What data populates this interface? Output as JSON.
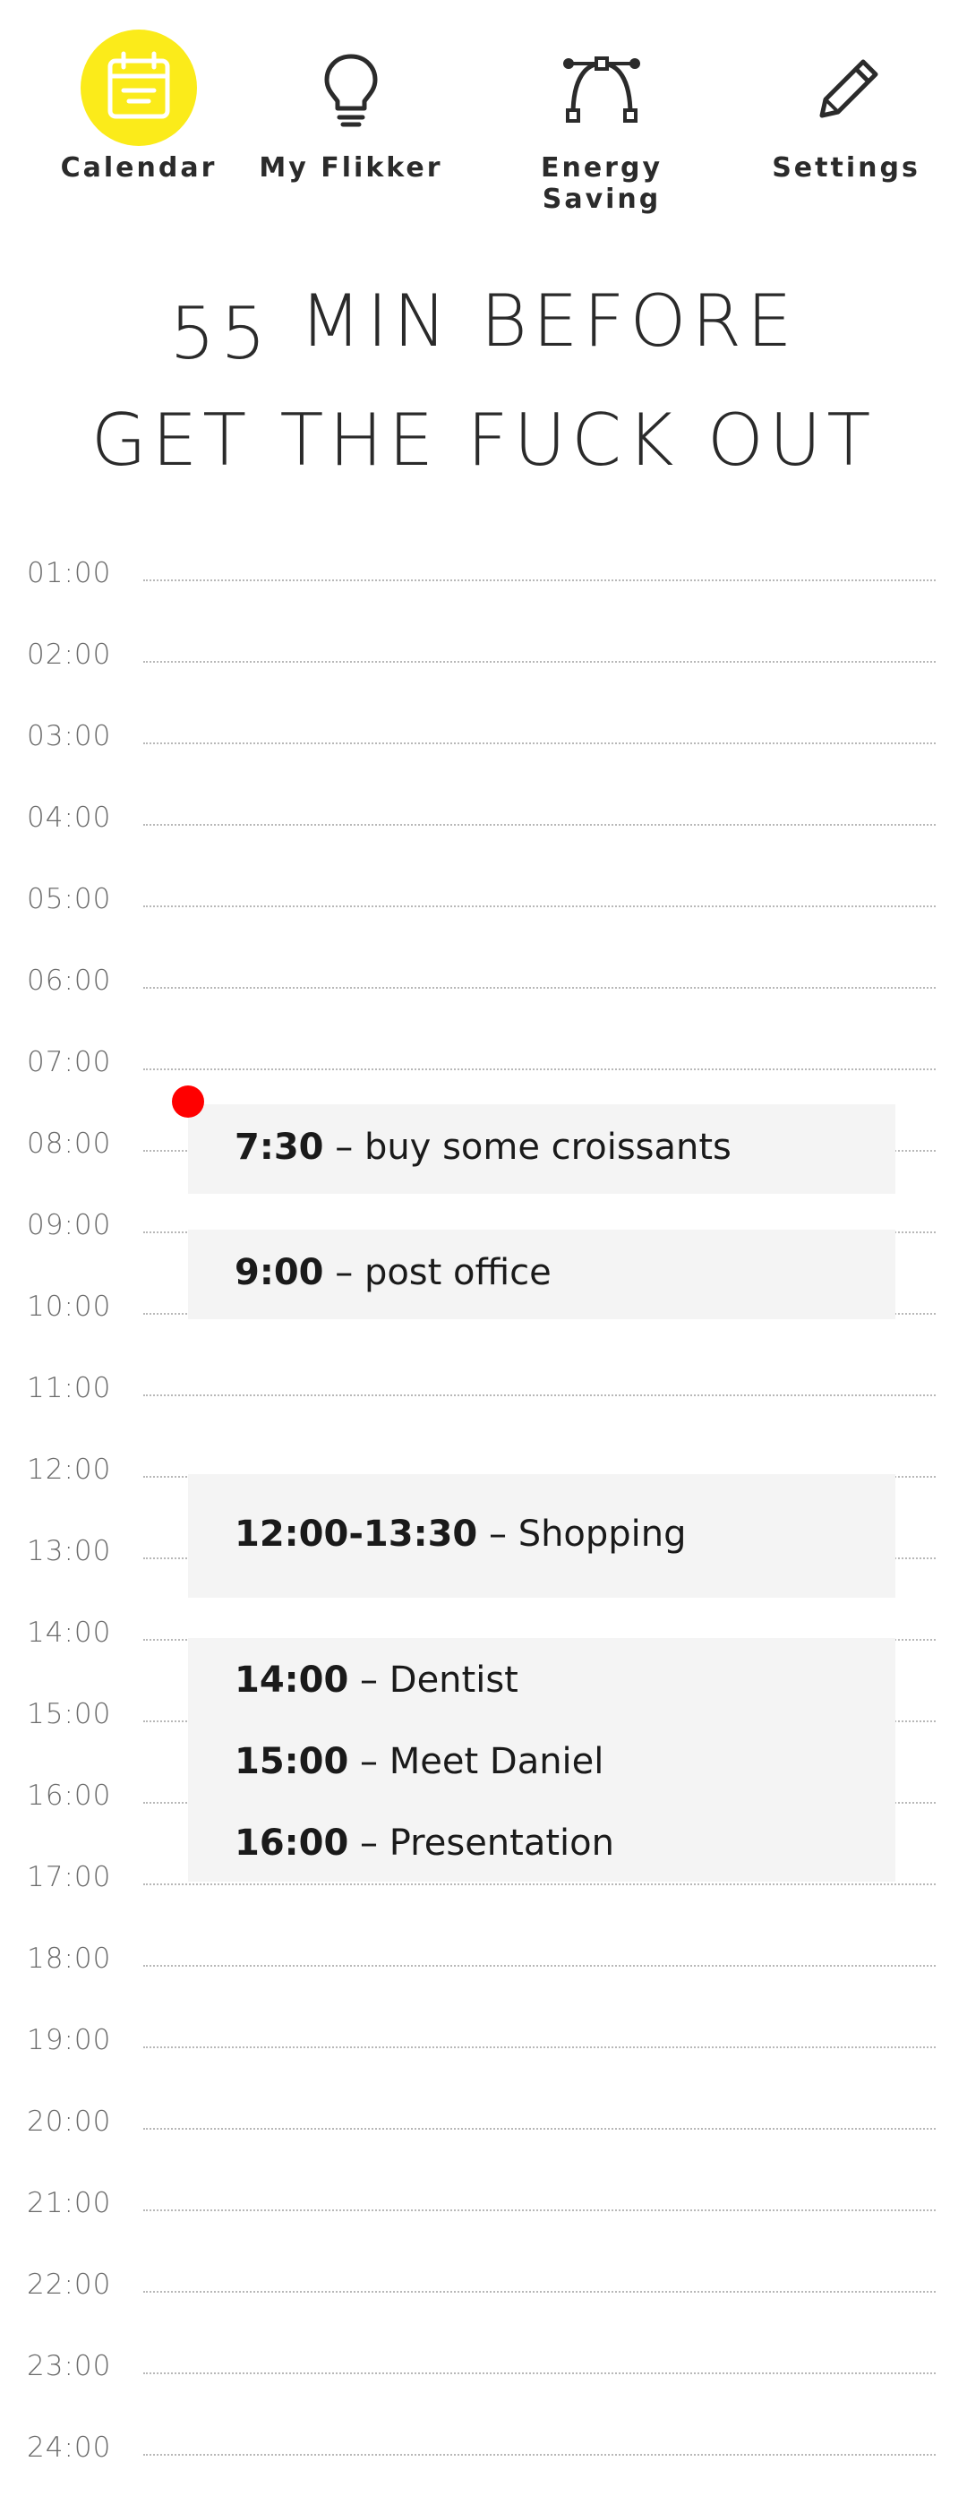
{
  "nav": {
    "items": [
      {
        "label": "Calendar",
        "icon": "calendar-icon",
        "active": true
      },
      {
        "label": "My Flikker",
        "icon": "lightbulb-icon",
        "active": false
      },
      {
        "label": "Energy Saving",
        "icon": "bezier-curve-icon",
        "active": false
      },
      {
        "label": "Settings",
        "icon": "pencil-icon",
        "active": false
      }
    ],
    "active_color": "#fbeb1a"
  },
  "headline": {
    "line1_number": "55",
    "line1_text": "MIN BEFORE",
    "line2": "GET THE FUCK OUT"
  },
  "hours": [
    "01:00",
    "02:00",
    "03:00",
    "04:00",
    "05:00",
    "06:00",
    "07:00",
    "08:00",
    "09:00",
    "10:00",
    "11:00",
    "12:00",
    "13:00",
    "14:00",
    "15:00",
    "16:00",
    "17:00",
    "18:00",
    "19:00",
    "20:00",
    "21:00",
    "22:00",
    "23:00",
    "24:00"
  ],
  "events": [
    {
      "time": "7:30",
      "title": "buy some croissants"
    },
    {
      "time": "9:00",
      "title": "post office"
    },
    {
      "time": "12:00-13:30",
      "title": "Shopping"
    },
    {
      "time": "14:00",
      "title": "Dentist"
    },
    {
      "time": "15:00",
      "title": "Meet Daniel"
    },
    {
      "time": "16:00",
      "title": "Presentation"
    }
  ],
  "separator": " – ",
  "now_indicator_color": "#ff0000"
}
